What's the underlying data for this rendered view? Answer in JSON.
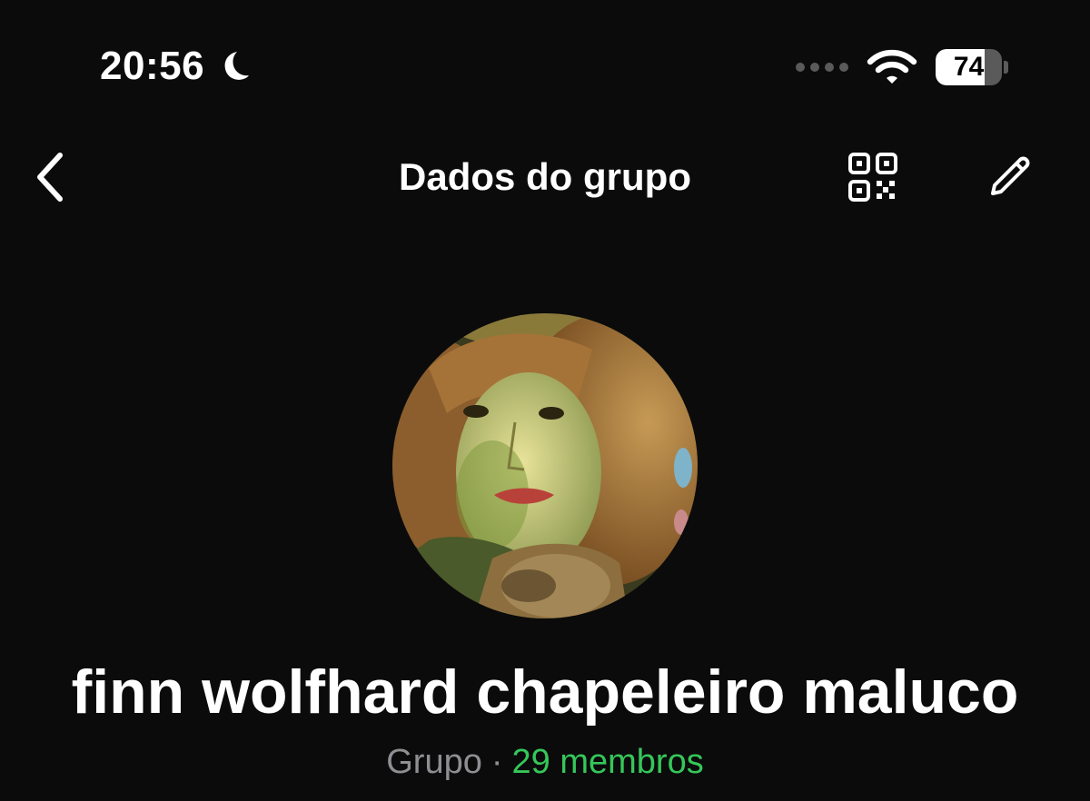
{
  "status_bar": {
    "time": "20:56",
    "focus_icon": "moon-icon",
    "wifi_icon": "wifi-icon",
    "battery_level": 74,
    "battery_label": "74"
  },
  "header": {
    "back_icon": "chevron-left-icon",
    "title": "Dados do grupo",
    "qr_icon": "qr-code-icon",
    "edit_icon": "pencil-icon"
  },
  "group": {
    "name": "finn wolfhard chapeleiro maluco",
    "type": "Grupo",
    "separator": "·",
    "members": "29 membros"
  },
  "colors": {
    "background": "#0b0b0b",
    "text": "#ffffff",
    "muted": "#8e8e93",
    "accent_green": "#35c75a"
  }
}
